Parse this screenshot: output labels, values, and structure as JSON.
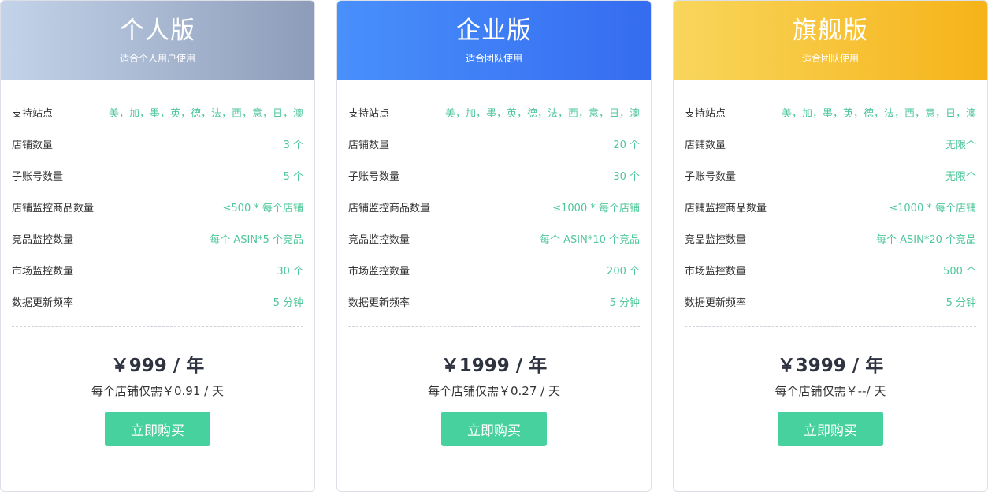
{
  "plans": [
    {
      "name": "个人版",
      "subtitle": "适合个人用户使用",
      "features": [
        {
          "label": "支持站点",
          "value": "美，加，墨，英，德，法，西，意，日，澳"
        },
        {
          "label": "店铺数量",
          "value": "3 个"
        },
        {
          "label": "子账号数量",
          "value": "5 个"
        },
        {
          "label": "店铺监控商品数量",
          "value": "≤500 * 每个店铺"
        },
        {
          "label": "竞品监控数量",
          "value": "每个 ASIN*5 个竞品"
        },
        {
          "label": "市场监控数量",
          "value": "30 个"
        },
        {
          "label": "数据更新频率",
          "value": "5 分钟"
        }
      ],
      "price": "￥999 / 年",
      "daily": "每个店铺仅需￥0.91 / 天",
      "button": "立即购买"
    },
    {
      "name": "企业版",
      "subtitle": "适合团队使用",
      "features": [
        {
          "label": "支持站点",
          "value": "美，加，墨，英，德，法，西，意，日，澳"
        },
        {
          "label": "店铺数量",
          "value": "20 个"
        },
        {
          "label": "子账号数量",
          "value": "30 个"
        },
        {
          "label": "店铺监控商品数量",
          "value": "≤1000 * 每个店铺"
        },
        {
          "label": "竞品监控数量",
          "value": "每个 ASIN*10 个竞品"
        },
        {
          "label": "市场监控数量",
          "value": "200 个"
        },
        {
          "label": "数据更新频率",
          "value": "5 分钟"
        }
      ],
      "price": "￥1999 / 年",
      "daily": "每个店铺仅需￥0.27 / 天",
      "button": "立即购买"
    },
    {
      "name": "旗舰版",
      "subtitle": "适合团队使用",
      "features": [
        {
          "label": "支持站点",
          "value": "美，加，墨，英，德，法，西，意，日，澳"
        },
        {
          "label": "店铺数量",
          "value": "无限个"
        },
        {
          "label": "子账号数量",
          "value": "无限个"
        },
        {
          "label": "店铺监控商品数量",
          "value": "≤1000 * 每个店铺"
        },
        {
          "label": "竞品监控数量",
          "value": "每个 ASIN*20 个竞品"
        },
        {
          "label": "市场监控数量",
          "value": "500 个"
        },
        {
          "label": "数据更新频率",
          "value": "5 分钟"
        }
      ],
      "price": "￥3999 / 年",
      "daily": "每个店铺仅需￥--/ 天",
      "button": "立即购买"
    }
  ],
  "colors": {
    "value_green": "#4fc79a",
    "button_green": "#47d19e",
    "personal_gradient": [
      "#c3d3e9",
      "#8d9db9"
    ],
    "enterprise_gradient": [
      "#4990fb",
      "#356cf0"
    ],
    "flagship_gradient": [
      "#f8d65c",
      "#f6b319"
    ]
  }
}
